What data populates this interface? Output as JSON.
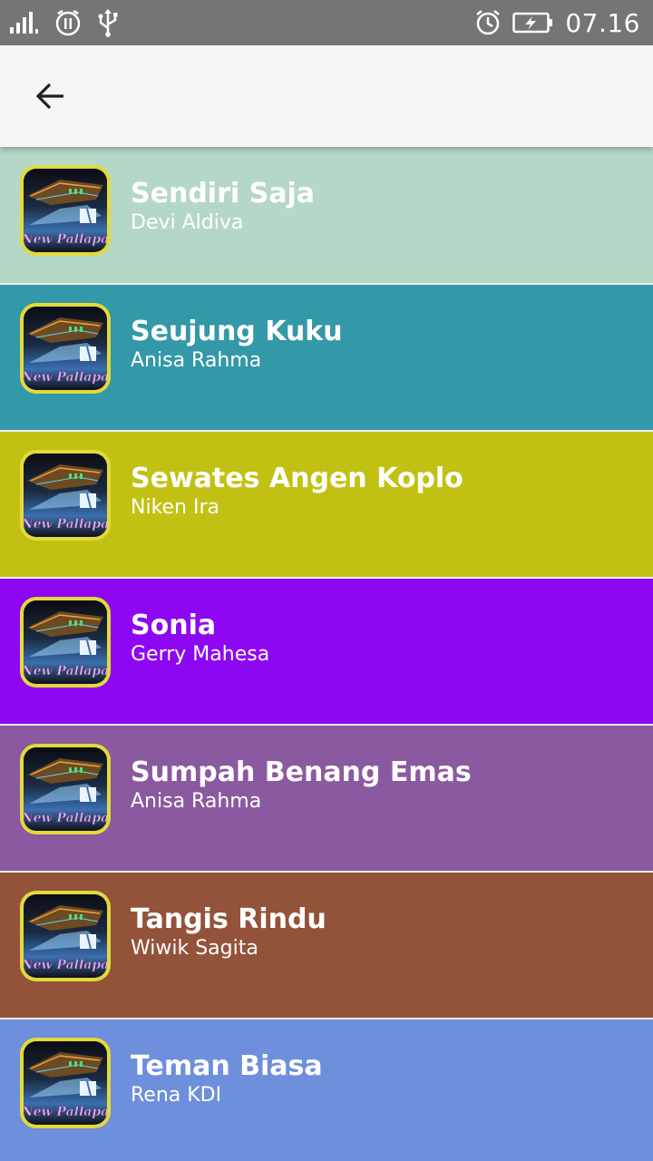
{
  "status_bar": {
    "time": "07.16",
    "icons": [
      "signal-icon",
      "no-disturb-icon",
      "usb-icon",
      "alarm-icon",
      "battery-charging-icon"
    ]
  },
  "toolbar": {
    "back_icon": "arrow-left-icon"
  },
  "songs": [
    {
      "title": "Sendiri Saja",
      "artist": "Devi Aldiva",
      "color": "#b4d8c5"
    },
    {
      "title": "Seujung Kuku",
      "artist": "Anisa Rahma",
      "color": "#3398a8"
    },
    {
      "title": "Sewates Angen Koplo",
      "artist": "Niken Ira",
      "color": "#c2c113"
    },
    {
      "title": "Sonia",
      "artist": "Gerry Mahesa",
      "color": "#8e07f2"
    },
    {
      "title": "Sumpah Benang Emas",
      "artist": "Anisa Rahma",
      "color": "#8b599f"
    },
    {
      "title": "Tangis Rindu",
      "artist": "Wiwik Sagita",
      "color": "#93533a"
    },
    {
      "title": "Teman Biasa",
      "artist": "Rena KDI",
      "color": "#6e8fdc"
    }
  ],
  "thumbnail_logo_text": "New Pallapa"
}
